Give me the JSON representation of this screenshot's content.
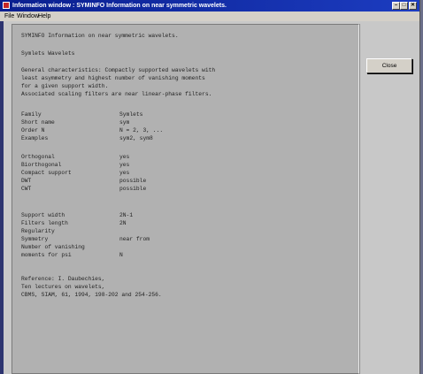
{
  "window": {
    "title": "Information window : SYMINFO Information on near symmetric wavelets.",
    "controls": [
      "minimize-icon",
      "maximize-icon",
      "close-icon"
    ]
  },
  "menu": {
    "items": [
      "File",
      "Window",
      "Help"
    ]
  },
  "buttons": {
    "close": "Close"
  },
  "content": {
    "heading": "SYMINFO Information on near symmetric wavelets.",
    "family_title": "Symlets Wavelets",
    "general": [
      "General characteristics: Compactly supported wavelets with",
      "least asymmetry and highest number of vanishing moments",
      "for a given support width.",
      "Associated scaling filters are near linear-phase filters."
    ],
    "props1": [
      {
        "k": "Family",
        "v": "Symlets"
      },
      {
        "k": "Short name",
        "v": "sym"
      },
      {
        "k": "Order N",
        "v": "N = 2, 3, ..."
      },
      {
        "k": "Examples",
        "v": "sym2, sym8"
      }
    ],
    "props2": [
      {
        "k": "Orthogonal",
        "v": "yes"
      },
      {
        "k": "Biorthogonal",
        "v": "yes"
      },
      {
        "k": "Compact support",
        "v": "yes"
      },
      {
        "k": "DWT",
        "v": "possible"
      },
      {
        "k": "CWT",
        "v": "possible"
      }
    ],
    "props3": [
      {
        "k": "Support width",
        "v": "2N-1"
      },
      {
        "k": "Filters length",
        "v": "2N"
      },
      {
        "k": "Regularity",
        "v": ""
      },
      {
        "k": "Symmetry",
        "v": "near from"
      },
      {
        "k": "Number of vanishing",
        "v": ""
      },
      {
        "k": "moments for psi",
        "v": "N"
      }
    ],
    "reference": [
      "Reference: I. Daubechies,",
      "Ten lectures on wavelets,",
      "CBMS, SIAM, 61, 1994, 198-202 and 254-256."
    ]
  }
}
